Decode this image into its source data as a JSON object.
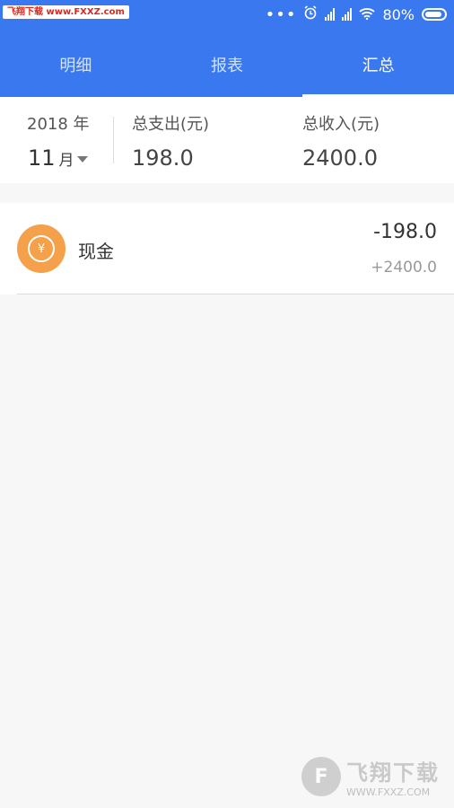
{
  "statusbar": {
    "watermark_text": "飞翔下载 www.FXXZ.com",
    "battery": "80%",
    "icons": [
      "more-dots-icon",
      "alarm-icon",
      "signal-icon",
      "signal-icon",
      "wifi-icon",
      "battery-icon"
    ]
  },
  "tabs": [
    {
      "label": "明细",
      "active": false
    },
    {
      "label": "报表",
      "active": false
    },
    {
      "label": "汇总",
      "active": true
    }
  ],
  "summary": {
    "year": "2018 年",
    "month": "11",
    "month_unit": "月",
    "expense_label": "总支出(元)",
    "expense_value": "198.0",
    "income_label": "总收入(元)",
    "income_value": "2400.0"
  },
  "accounts": [
    {
      "icon": "yen-icon",
      "icon_glyph": "¥",
      "name": "现金",
      "expense": "-198.0",
      "income": "+2400.0"
    }
  ],
  "watermark": {
    "big": "飞翔下载",
    "small": "WWW.FXXZ.COM",
    "glyph": "F"
  },
  "colors": {
    "primary": "#3a78ef",
    "accent_orange": "#f5a04a",
    "background": "#f7f7f7"
  }
}
